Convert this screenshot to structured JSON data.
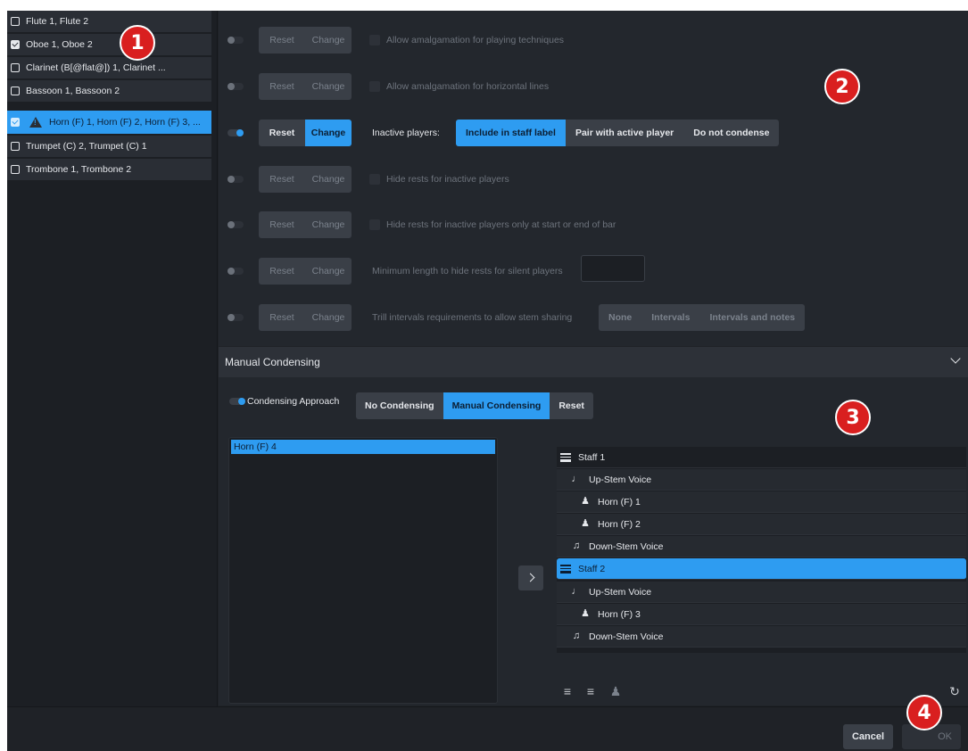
{
  "players": [
    {
      "label": "Flute 1, Flute 2",
      "checked": false,
      "warning": false,
      "selected": false
    },
    {
      "label": "Oboe 1, Oboe 2",
      "checked": true,
      "warning": false,
      "selected": false
    },
    {
      "label": "Clarinet (B[@flat@]) 1, Clarinet ...",
      "checked": false,
      "warning": false,
      "selected": false
    },
    {
      "label": "Bassoon 1, Bassoon 2",
      "checked": false,
      "warning": false,
      "selected": false
    },
    {
      "label": "Horn (F) 1, Horn (F) 2, Horn (F) 3, ...",
      "checked": true,
      "warning": true,
      "selected": true
    },
    {
      "label": "Trumpet (C) 2, Trumpet (C) 1",
      "checked": false,
      "warning": false,
      "selected": false
    },
    {
      "label": "Trombone 1, Trombone 2",
      "checked": false,
      "warning": false,
      "selected": false
    }
  ],
  "options": {
    "reset_label": "Reset",
    "change_label": "Change",
    "rows": [
      {
        "label": "Allow amalgamation for playing techniques",
        "active": false
      },
      {
        "label": "Allow amalgamation for horizontal lines",
        "active": false
      },
      {
        "label": "Inactive players:",
        "active": true,
        "choices": [
          "Include in staff label",
          "Pair with active player",
          "Do not condense"
        ],
        "selected_choice": "Include in staff label"
      },
      {
        "label": "Hide rests for inactive players",
        "active": false
      },
      {
        "label": "Hide rests for inactive players only at start or end of bar",
        "active": false
      },
      {
        "label": "Minimum length to hide rests for silent players",
        "active": false
      },
      {
        "label": "Trill intervals requirements to allow stem sharing",
        "active": false,
        "choices": [
          "None",
          "Intervals",
          "Intervals and notes"
        ]
      }
    ]
  },
  "manual_condensing": {
    "title": "Manual Condensing",
    "approach_label": "Condensing Approach",
    "approach_choices": [
      "No Condensing",
      "Manual Condensing",
      "Reset"
    ],
    "approach_selected": "Manual Condensing",
    "available": [
      "Horn (F) 4"
    ],
    "tree": [
      {
        "label": "Staff 1",
        "kind": "staff",
        "level": 0
      },
      {
        "label": "Up-Stem Voice",
        "kind": "up-voice",
        "level": 1
      },
      {
        "label": "Horn (F) 1",
        "kind": "player",
        "level": 2
      },
      {
        "label": "Horn (F) 2",
        "kind": "player",
        "level": 2
      },
      {
        "label": "Down-Stem Voice",
        "kind": "down-voice",
        "level": 1
      },
      {
        "label": "Staff 2",
        "kind": "staff",
        "level": 0,
        "selected": true
      },
      {
        "label": "Up-Stem Voice",
        "kind": "up-voice",
        "level": 1
      },
      {
        "label": "Horn (F) 3",
        "kind": "player",
        "level": 2
      },
      {
        "label": "Down-Stem Voice",
        "kind": "down-voice",
        "level": 1
      }
    ],
    "tools": [
      "add-staff-icon",
      "remove-staff-icon",
      "add-player-icon",
      "reset-icon"
    ]
  },
  "footer": {
    "cancel_label": "Cancel",
    "ok_label": "OK"
  },
  "callouts": [
    "1",
    "2",
    "3",
    "4"
  ],
  "colors": {
    "accent": "#2e9cf1",
    "callout": "#d91f1f",
    "background": "#1f2227"
  }
}
